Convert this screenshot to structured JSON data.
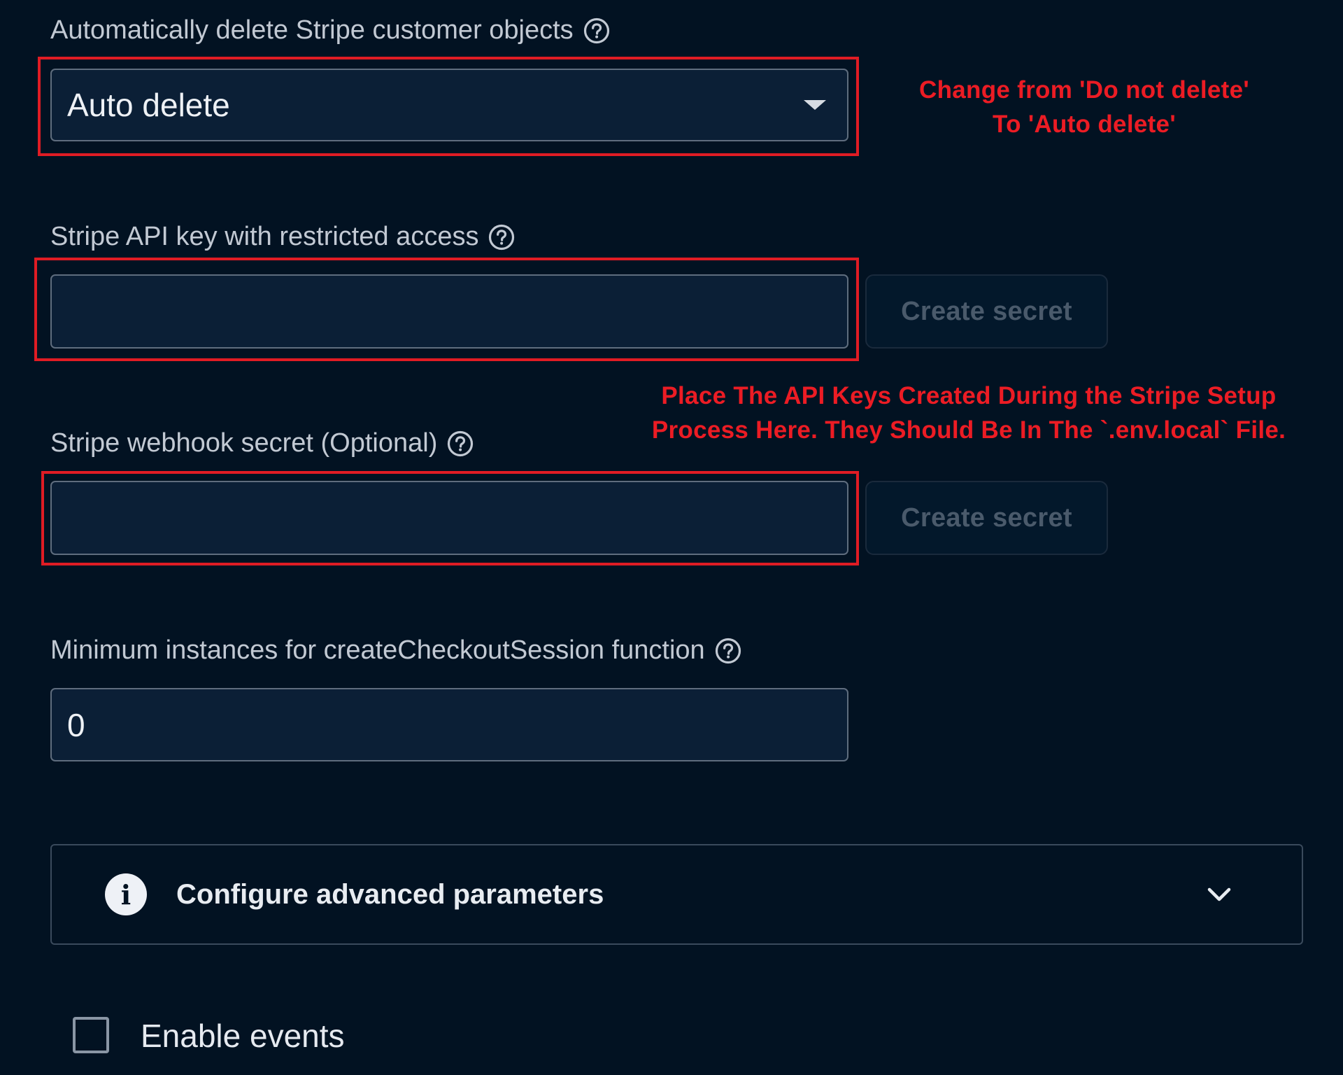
{
  "auto_delete": {
    "label": "Automatically delete Stripe customer objects",
    "selected": "Auto delete",
    "help_icon": "help-circle-icon",
    "caret_icon": "caret-down-icon"
  },
  "annotation_top": {
    "line1": "Change from 'Do not delete'",
    "line2": "To 'Auto delete'"
  },
  "api_key": {
    "label": "Stripe API key with restricted access",
    "value": "",
    "button_label": "Create secret"
  },
  "annotation_middle": {
    "line1": "Place The API Keys Created During the Stripe Setup",
    "line2": "Process Here. They Should Be In The `.env.local` File."
  },
  "webhook": {
    "label": "Stripe webhook secret (Optional)",
    "value": "",
    "button_label": "Create secret"
  },
  "min_instances": {
    "label": "Minimum instances for createCheckoutSession function",
    "value": "0"
  },
  "advanced": {
    "title": "Configure advanced parameters",
    "icon": "info-icon",
    "chevron": "chevron-down-icon"
  },
  "events": {
    "label": "Enable events",
    "checked": false
  },
  "colors": {
    "background": "#021222",
    "input_bg": "#0b1f36",
    "annotation_red": "#ec1c24",
    "disabled_button_text": "#4a5a6b"
  }
}
